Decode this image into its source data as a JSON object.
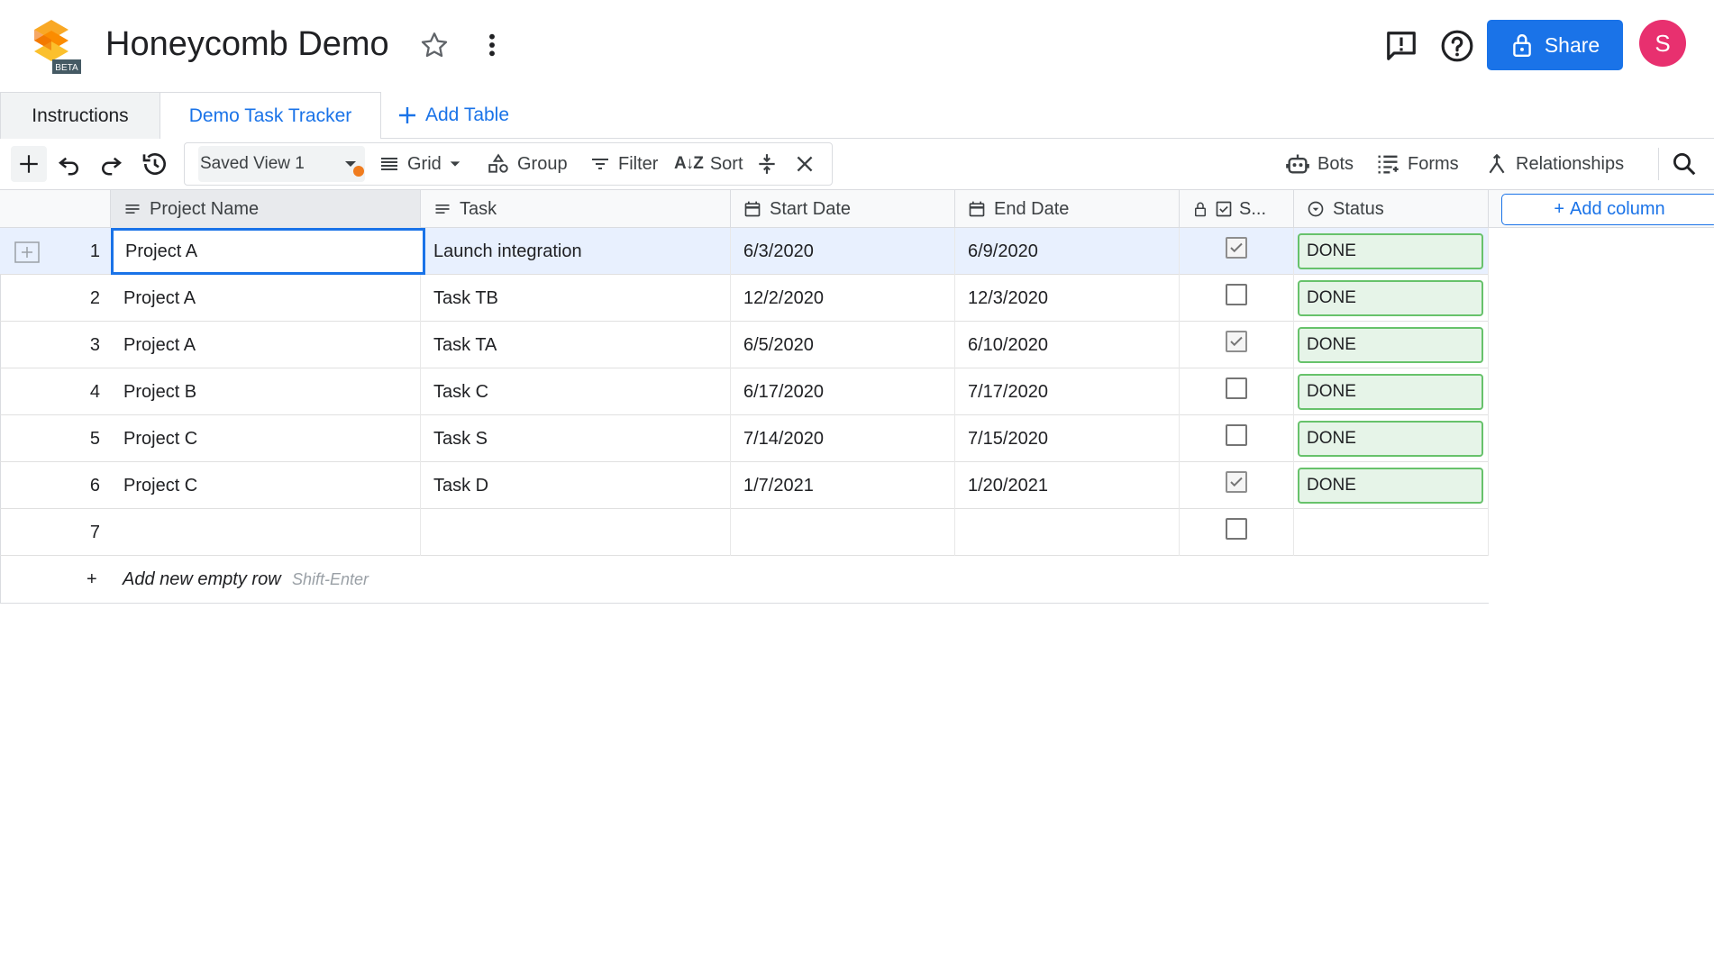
{
  "app": {
    "title": "Honeycomb Demo",
    "logo_badge": "BETA",
    "share_label": "Share",
    "avatar_initial": "S",
    "accent_color": "#1a73e8",
    "avatar_color": "#e8306f"
  },
  "tabs": [
    {
      "label": "Instructions",
      "active": false
    },
    {
      "label": "Demo Task Tracker",
      "active": true
    }
  ],
  "add_table_label": "Add Table",
  "toolbar": {
    "saved_view": "Saved View 1",
    "grid_label": "Grid",
    "group_label": "Group",
    "filter_label": "Filter",
    "sort_label": "Sort",
    "bots_label": "Bots",
    "forms_label": "Forms",
    "relationships_label": "Relationships"
  },
  "columns": {
    "project": "Project Name",
    "task": "Task",
    "start": "Start Date",
    "end": "End Date",
    "done": "S...",
    "status": "Status",
    "add_column": "Add column"
  },
  "rows": [
    {
      "num": "1",
      "project": "Project A",
      "task": "Launch integration",
      "start": "6/3/2020",
      "end": "6/9/2020",
      "checked": true,
      "status": "DONE"
    },
    {
      "num": "2",
      "project": "Project A",
      "task": "Task TB",
      "start": "12/2/2020",
      "end": "12/3/2020",
      "checked": false,
      "status": "DONE"
    },
    {
      "num": "3",
      "project": "Project A",
      "task": "Task TA",
      "start": "6/5/2020",
      "end": "6/10/2020",
      "checked": true,
      "status": "DONE"
    },
    {
      "num": "4",
      "project": "Project B",
      "task": "Task C",
      "start": "6/17/2020",
      "end": "7/17/2020",
      "checked": false,
      "status": "DONE"
    },
    {
      "num": "5",
      "project": "Project C",
      "task": "Task S",
      "start": "7/14/2020",
      "end": "7/15/2020",
      "checked": false,
      "status": "DONE"
    },
    {
      "num": "6",
      "project": "Project C",
      "task": "Task D",
      "start": "1/7/2021",
      "end": "1/20/2021",
      "checked": true,
      "status": "DONE"
    },
    {
      "num": "7",
      "project": "",
      "task": "",
      "start": "",
      "end": "",
      "checked": false,
      "status": ""
    }
  ],
  "add_row": {
    "plus": "+",
    "label": "Add new empty row",
    "hint": "Shift-Enter"
  }
}
